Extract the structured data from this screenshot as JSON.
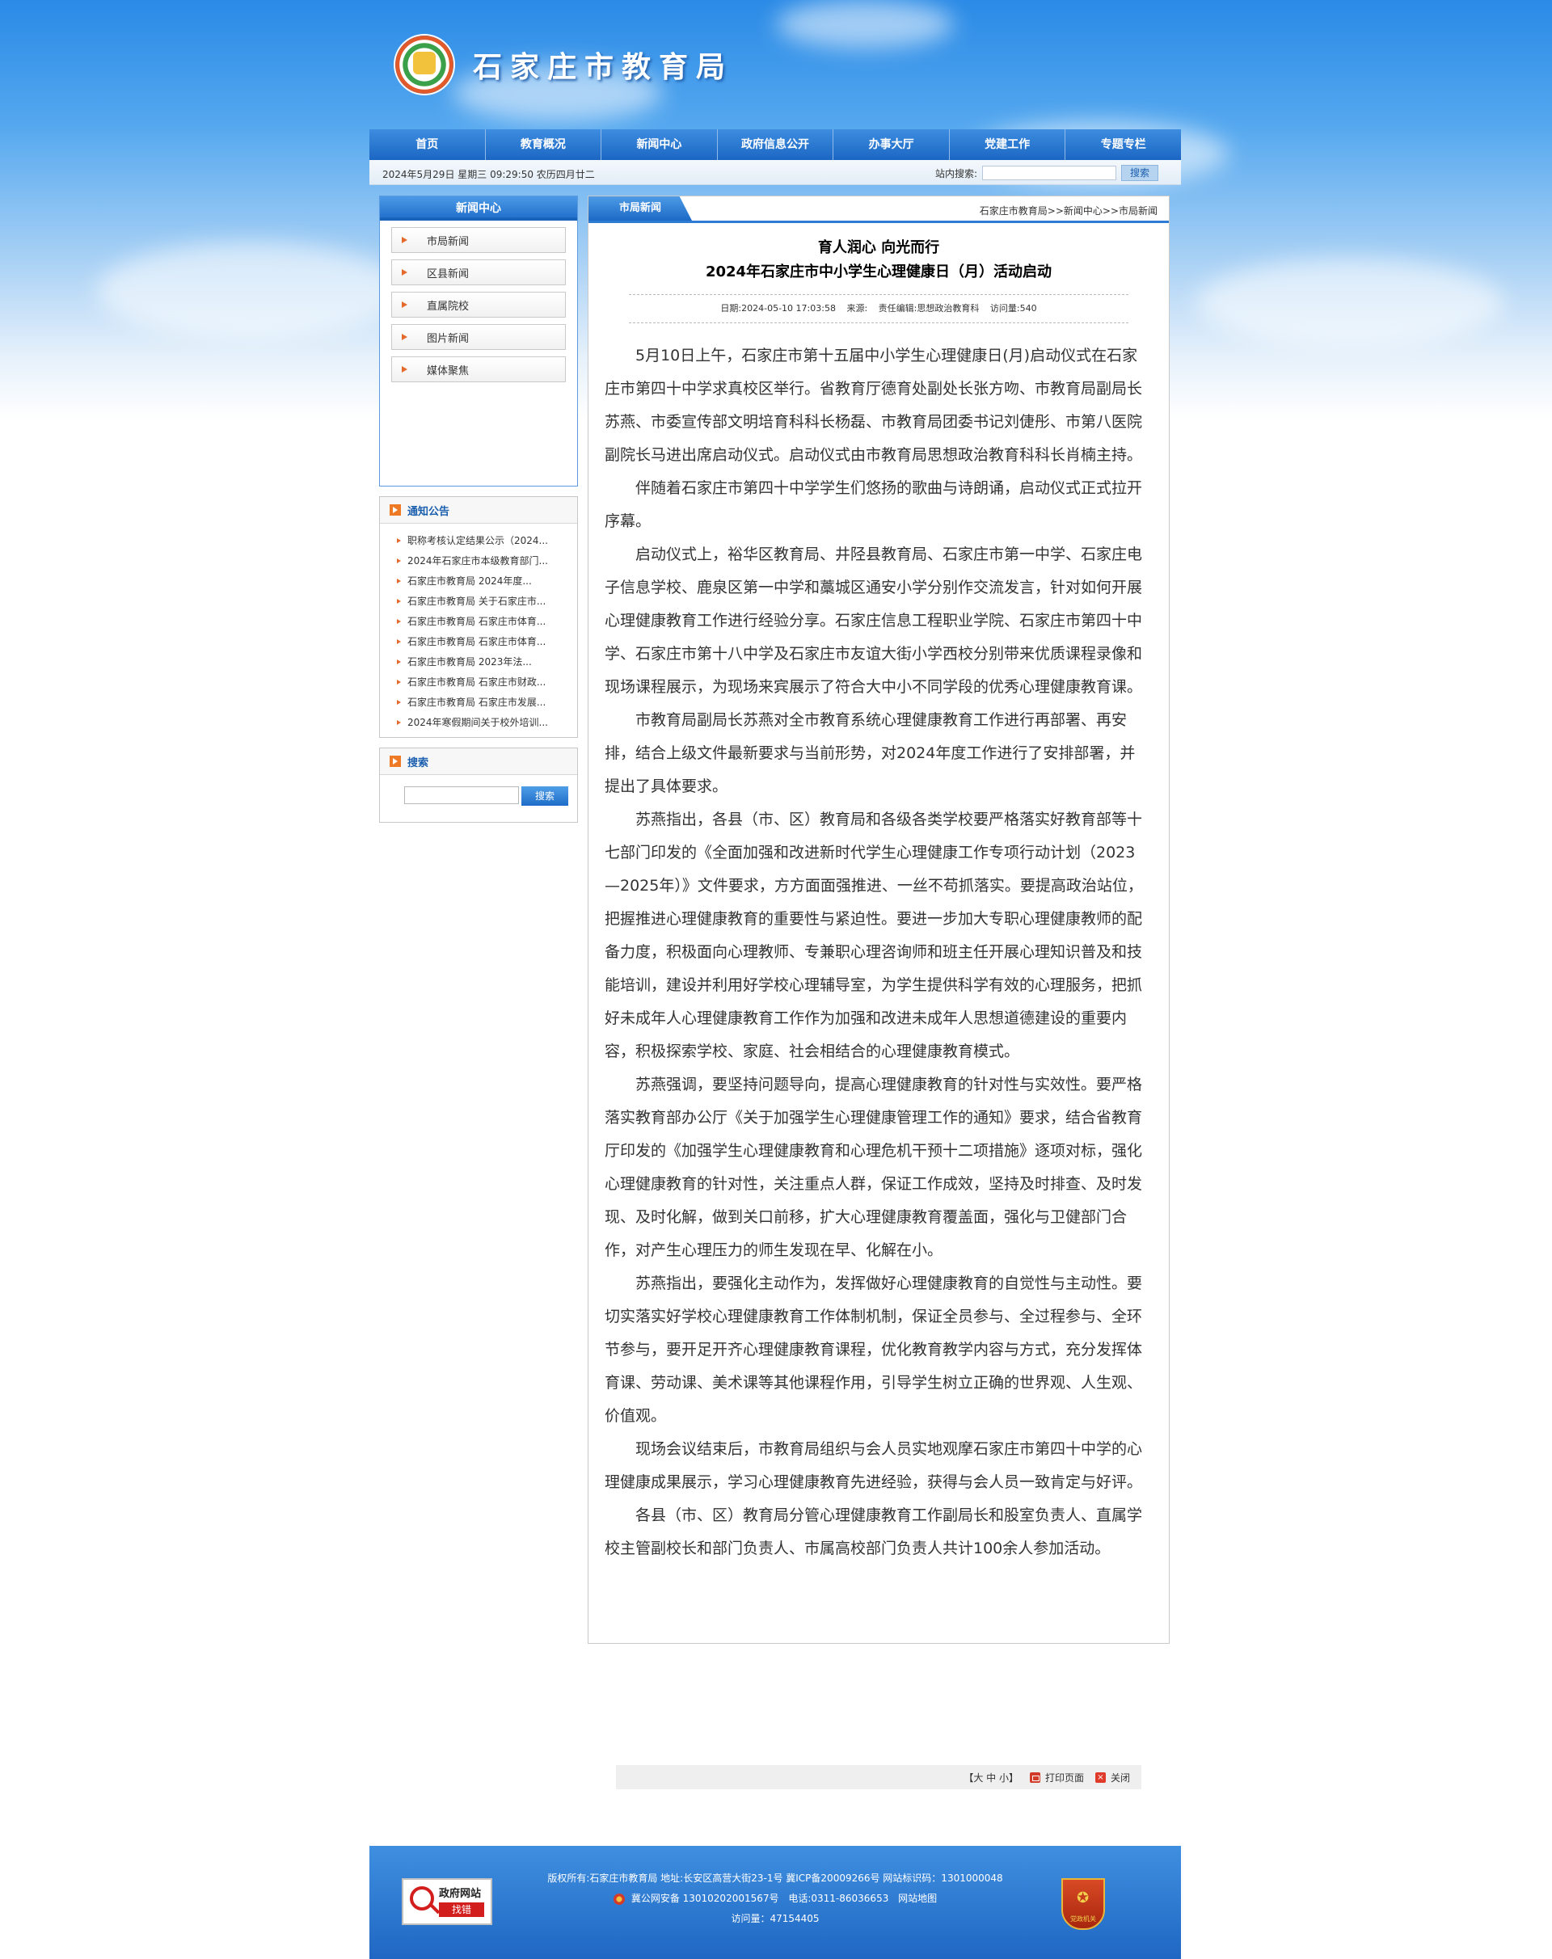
{
  "site": {
    "name": "石家庄市教育局"
  },
  "nav": [
    "首页",
    "教育概况",
    "新闻中心",
    "政府信息公开",
    "办事大厅",
    "党建工作",
    "专题专栏"
  ],
  "topbar": {
    "date": "2024年5月29日 星期三 09:29:50 农历四月廿二",
    "search_label": "站内搜索:",
    "search_button": "搜索"
  },
  "sidebar": {
    "news_title": "新闻中心",
    "news_items": [
      "市局新闻",
      "区县新闻",
      "直属院校",
      "图片新闻",
      "媒体聚焦"
    ],
    "notice_title": "通知公告",
    "notices": [
      "职称考核认定结果公示（2024...",
      "2024年石家庄市本级教育部门...",
      "石家庄市教育局 2024年度...",
      "石家庄市教育局 关于石家庄市...",
      "石家庄市教育局 石家庄市体育...",
      "石家庄市教育局 石家庄市体育...",
      "石家庄市教育局 2023年法...",
      "石家庄市教育局 石家庄市财政...",
      "石家庄市教育局 石家庄市发展...",
      "2024年寒假期间关于校外培训..."
    ],
    "search_title": "搜索",
    "search_button": "搜索"
  },
  "article": {
    "tab": "市局新闻",
    "breadcrumb": "石家庄市教育局>>新闻中心>>市局新闻",
    "title_line1": "育人润心 向光而行",
    "title_line2": "2024年石家庄市中小学生心理健康日（月）活动启动",
    "meta": {
      "date": "日期:2024-05-10 17:03:58",
      "source": "来源:",
      "editor": "责任编辑:思想政治教育科",
      "views": "访问量:540"
    },
    "paragraphs": [
      "5月10日上午，石家庄市第十五届中小学生心理健康日(月)启动仪式在石家庄市第四十中学求真校区举行。省教育厅德育处副处长张方吻、市教育局副局长苏燕、市委宣传部文明培育科科长杨磊、市教育局团委书记刘倢彤、市第八医院副院长马进出席启动仪式。启动仪式由市教育局思想政治教育科科长肖楠主持。",
      "伴随着石家庄市第四十中学学生们悠扬的歌曲与诗朗诵，启动仪式正式拉开序幕。",
      "启动仪式上，裕华区教育局、井陉县教育局、石家庄市第一中学、石家庄电子信息学校、鹿泉区第一中学和藁城区通安小学分别作交流发言，针对如何开展心理健康教育工作进行经验分享。石家庄信息工程职业学院、石家庄市第四十中学、石家庄市第十八中学及石家庄市友谊大街小学西校分别带来优质课程录像和现场课程展示，为现场来宾展示了符合大中小不同学段的优秀心理健康教育课。",
      "市教育局副局长苏燕对全市教育系统心理健康教育工作进行再部署、再安排，结合上级文件最新要求与当前形势，对2024年度工作进行了安排部署，并提出了具体要求。",
      "苏燕指出，各县（市、区）教育局和各级各类学校要严格落实好教育部等十七部门印发的《全面加强和改进新时代学生心理健康工作专项行动计划（2023—2025年）》文件要求，方方面面强推进、一丝不苟抓落实。要提高政治站位，把握推进心理健康教育的重要性与紧迫性。要进一步加大专职心理健康教师的配备力度，积极面向心理教师、专兼职心理咨询师和班主任开展心理知识普及和技能培训，建设并利用好学校心理辅导室，为学生提供科学有效的心理服务，把抓好未成年人心理健康教育工作作为加强和改进未成年人思想道德建设的重要内容，积极探索学校、家庭、社会相结合的心理健康教育模式。",
      "苏燕强调，要坚持问题导向，提高心理健康教育的针对性与实效性。要严格落实教育部办公厅《关于加强学生心理健康管理工作的通知》要求，结合省教育厅印发的《加强学生心理健康教育和心理危机干预十二项措施》逐项对标，强化心理健康教育的针对性，关注重点人群，保证工作成效，坚持及时排查、及时发现、及时化解，做到关口前移，扩大心理健康教育覆盖面，强化与卫健部门合作，对产生心理压力的师生发现在早、化解在小。",
      "苏燕指出，要强化主动作为，发挥做好心理健康教育的自觉性与主动性。要切实落实好学校心理健康教育工作体制机制，保证全员参与、全过程参与、全环节参与，要开足开齐心理健康教育课程，优化教育教学内容与方式，充分发挥体育课、劳动课、美术课等其他课程作用，引导学生树立正确的世界观、人生观、价值观。",
      "现场会议结束后，市教育局组织与会人员实地观摩石家庄市第四十中学的心理健康成果展示，学习心理健康教育先进经验，获得与会人员一致肯定与好评。",
      "各县（市、区）教育局分管心理健康教育工作副局长和股室负责人、直属学校主管副校长和部门负责人、市属高校部门负责人共计100余人参加活动。"
    ],
    "tools": {
      "size": "【大 中 小】",
      "print": "打印页面",
      "close": "关闭"
    }
  },
  "footer": {
    "line1": "版权所有:石家庄市教育局 地址:长安区高营大街23-1号 冀ICP备20009266号 网站标识码：1301000048",
    "police": "冀公网安备 13010202001567号",
    "phone": "电话:0311-86036653",
    "sitemap": "网站地图",
    "visits": "访问量：47154405",
    "gov_badge_title": "政府网站",
    "gov_badge_sub": "找错",
    "party_badge": "党政机关"
  },
  "colors": {
    "nav_blue": "#1b66c3",
    "accent_orange": "#ef7a26"
  }
}
